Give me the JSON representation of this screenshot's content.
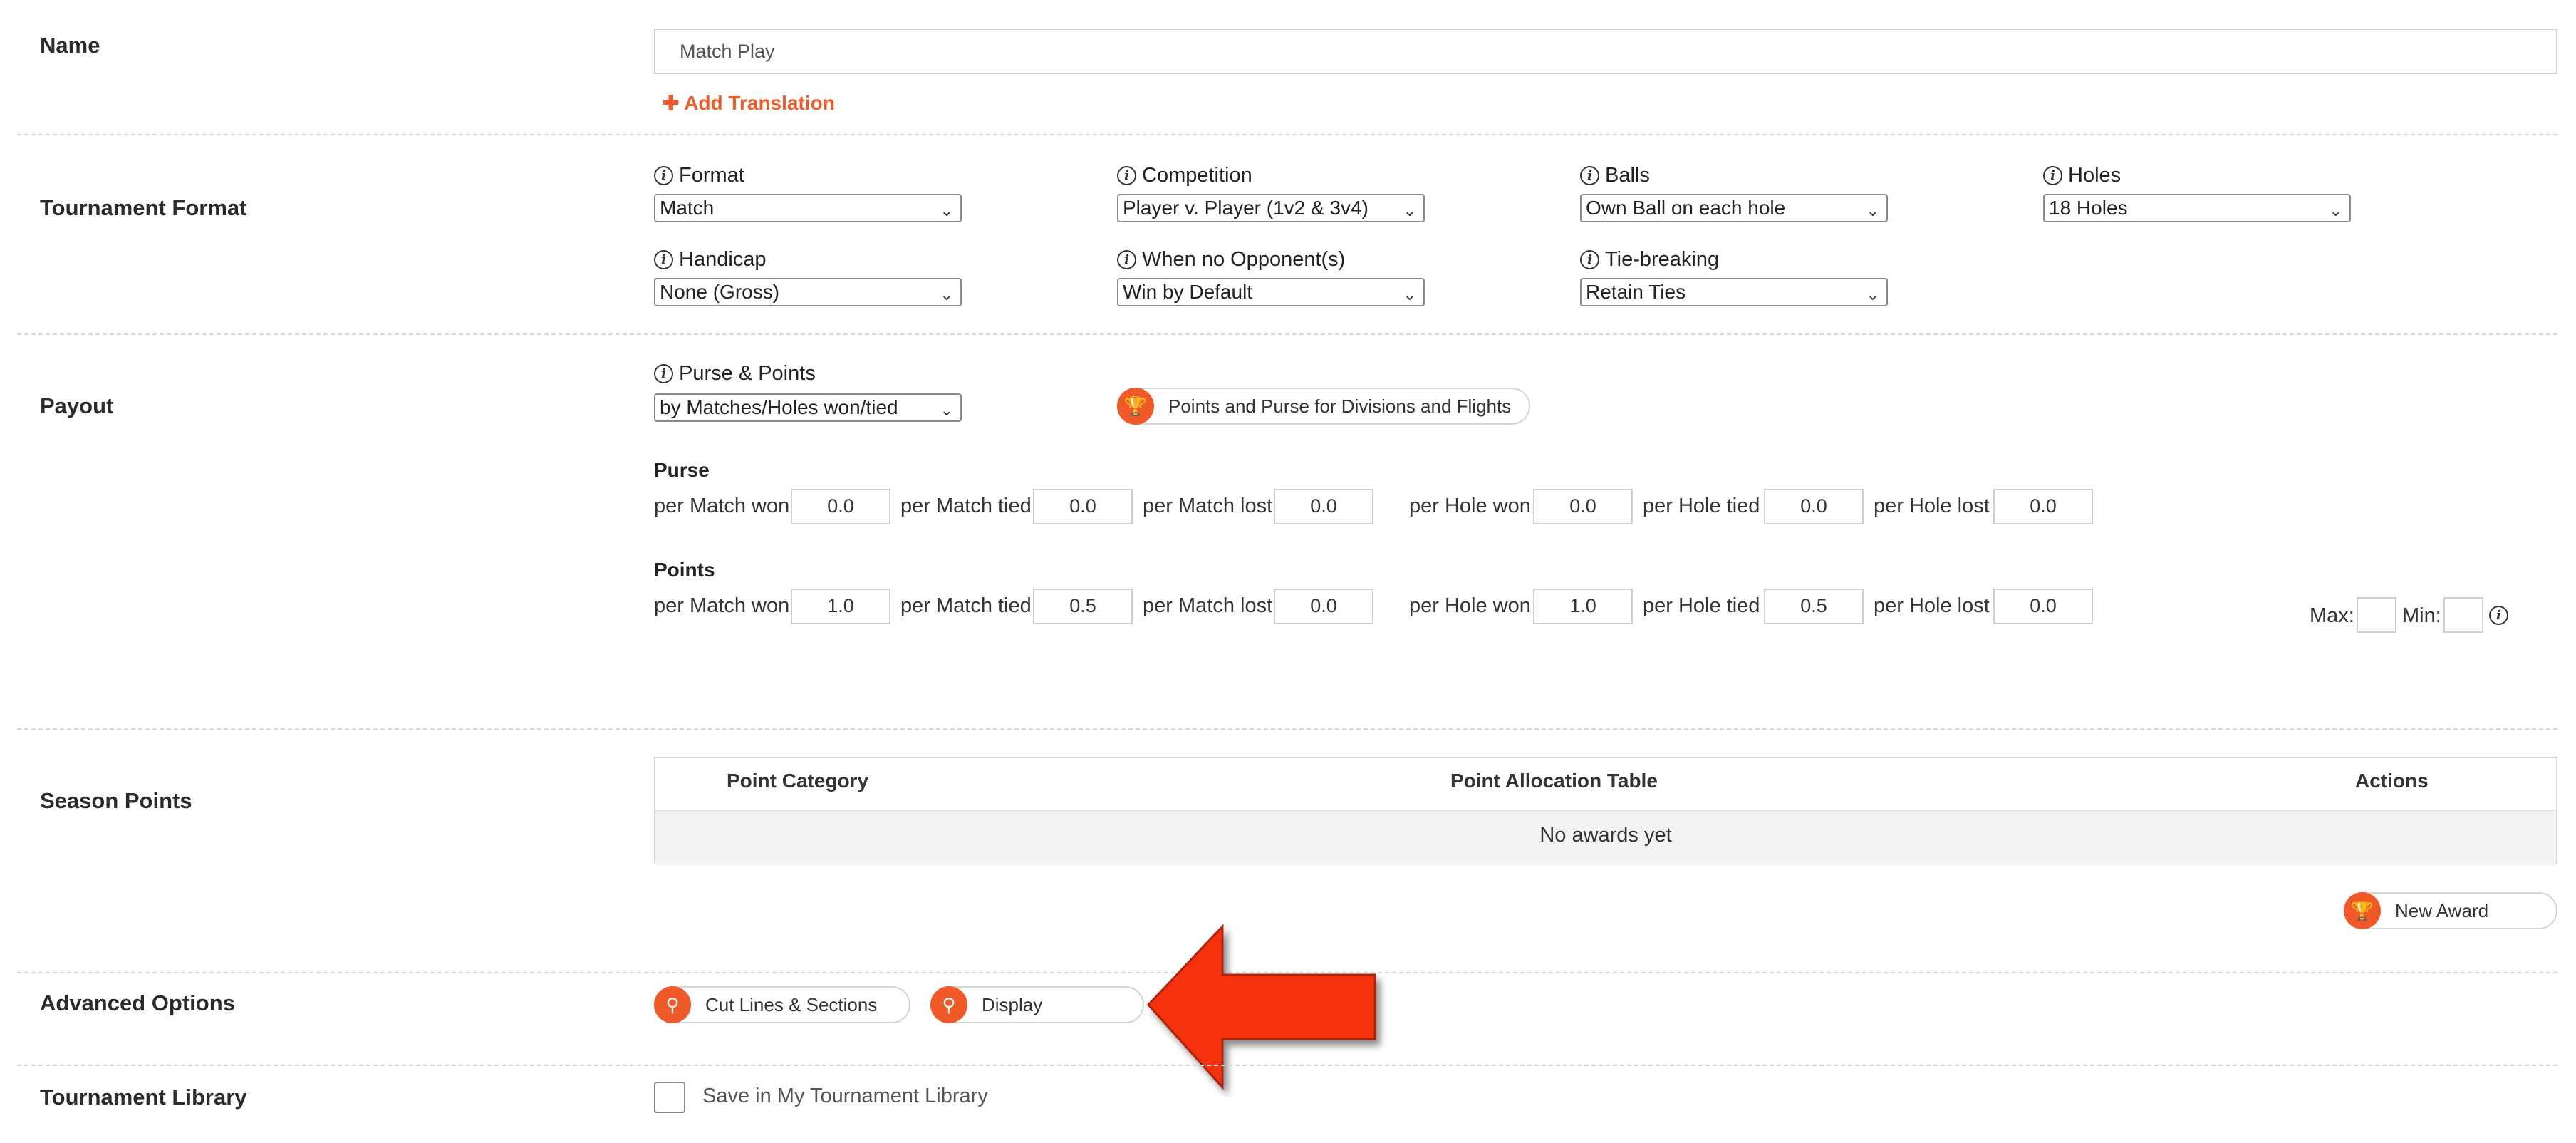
{
  "name_section": {
    "label": "Name",
    "input_value": "Match Play",
    "add_translation": "Add Translation",
    "add_translation_icon": "plus-icon"
  },
  "format_section": {
    "label": "Tournament Format",
    "fields": {
      "format": {
        "label": "Format",
        "value": "Match"
      },
      "competition": {
        "label": "Competition",
        "value": "Player v. Player (1v2 & 3v4)"
      },
      "balls": {
        "label": "Balls",
        "value": "Own Ball on each hole"
      },
      "holes": {
        "label": "Holes",
        "value": "18 Holes"
      },
      "handicap": {
        "label": "Handicap",
        "value": "None (Gross)"
      },
      "no_opponent": {
        "label": "When no Opponent(s)",
        "value": "Win by Default"
      },
      "tie_breaking": {
        "label": "Tie-breaking",
        "value": "Retain Ties"
      }
    }
  },
  "payout_section": {
    "label": "Payout",
    "purse_points": {
      "label": "Purse & Points",
      "value": "by Matches/Holes won/tied"
    },
    "divisions_button": "Points and Purse for Divisions and Flights",
    "purse": {
      "heading": "Purse",
      "match_won_label": "per Match won",
      "match_won": "0.0",
      "match_tied_label": "per Match tied",
      "match_tied": "0.0",
      "match_lost_label": "per Match lost",
      "match_lost": "0.0",
      "hole_won_label": "per Hole won",
      "hole_won": "0.0",
      "hole_tied_label": "per Hole tied",
      "hole_tied": "0.0",
      "hole_lost_label": "per Hole lost",
      "hole_lost": "0.0"
    },
    "points": {
      "heading": "Points",
      "match_won_label": "per Match won",
      "match_won": "1.0",
      "match_tied_label": "per Match tied",
      "match_tied": "0.5",
      "match_lost_label": "per Match lost",
      "match_lost": "0.0",
      "hole_won_label": "per Hole won",
      "hole_won": "1.0",
      "hole_tied_label": "per Hole tied",
      "hole_tied": "0.5",
      "hole_lost_label": "per Hole lost",
      "hole_lost": "0.0",
      "max_label": "Max:",
      "min_label": "Min:"
    }
  },
  "season_section": {
    "label": "Season Points",
    "columns": [
      "Point Category",
      "Point Allocation Table",
      "Actions"
    ],
    "empty_text": "No awards yet",
    "new_award_button": "New Award"
  },
  "advanced_section": {
    "label": "Advanced Options",
    "cut_lines_button": "Cut Lines & Sections",
    "display_button": "Display"
  },
  "library_section": {
    "label": "Tournament Library",
    "checkbox_label": "Save in My Tournament Library"
  },
  "colors": {
    "accent": "#f05a28",
    "arrow": "#f4330f"
  }
}
